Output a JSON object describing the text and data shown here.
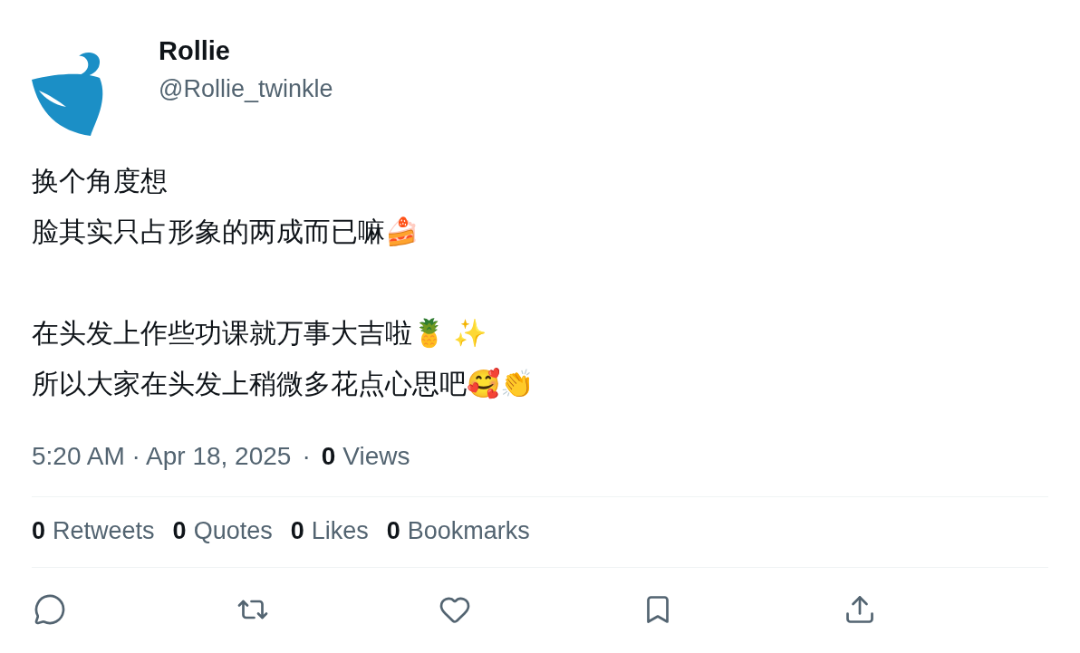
{
  "author": {
    "name": "Rollie",
    "handle": "@Rollie_twinkle"
  },
  "paragraphs": [
    [
      "换个角度想",
      "脸其实只占形象的两成而已嘛🍰"
    ],
    [
      "在头发上作些功课就万事大吉啦🍍 ✨",
      "所以大家在头发上稍微多花点心思吧🥰👏"
    ]
  ],
  "meta": {
    "timestamp": "5:20 AM · Apr 18, 2025",
    "separator": "·",
    "views_count": "0",
    "views_label": "Views"
  },
  "stats": [
    {
      "count": "0",
      "label": "Retweets"
    },
    {
      "count": "0",
      "label": "Quotes"
    },
    {
      "count": "0",
      "label": "Likes"
    },
    {
      "count": "0",
      "label": "Bookmarks"
    }
  ],
  "actions": [
    {
      "kind": "reply"
    },
    {
      "kind": "retweet"
    },
    {
      "kind": "like"
    },
    {
      "kind": "bookmark"
    },
    {
      "kind": "share"
    }
  ]
}
